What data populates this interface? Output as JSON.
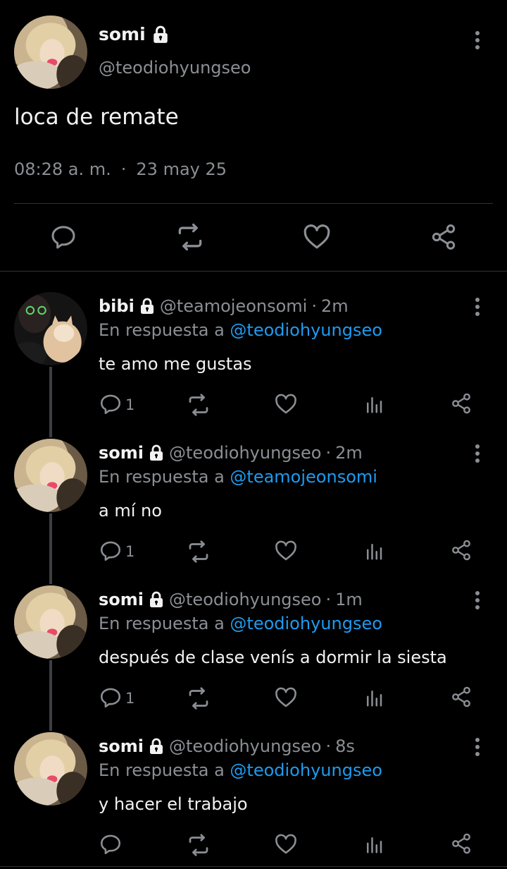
{
  "main_tweet": {
    "author_name": "somi",
    "author_handle": "@teodiohyungseo",
    "text": "loca de remate",
    "time": "08:28 a. m.",
    "separator": "·",
    "date": "23 may 25"
  },
  "replies": [
    {
      "name": "bibi",
      "handle": "@teamojeonsomi",
      "dot": "·",
      "time": "2m",
      "reply_prefix": "En respuesta a",
      "reply_to": "@teodiohyungseo",
      "text": "te amo me gustas",
      "reply_count": "1"
    },
    {
      "name": "somi",
      "handle": "@teodiohyungseo",
      "dot": "·",
      "time": "2m",
      "reply_prefix": "En respuesta a",
      "reply_to": "@teamojeonsomi",
      "text": "a mí no",
      "reply_count": "1"
    },
    {
      "name": "somi",
      "handle": "@teodiohyungseo",
      "dot": "·",
      "time": "1m",
      "reply_prefix": "En respuesta a",
      "reply_to": "@teodiohyungseo",
      "text": "después de clase venís a dormir la siesta",
      "reply_count": "1"
    },
    {
      "name": "somi",
      "handle": "@teodiohyungseo",
      "dot": "·",
      "time": "8s",
      "reply_prefix": "En respuesta a",
      "reply_to": "@teodiohyungseo",
      "text": "y hacer el trabajo",
      "reply_count": ""
    }
  ],
  "colors": {
    "background": "#000000",
    "text": "#e7e9ea",
    "secondary": "#8b8f94",
    "mention": "#1d9bf0",
    "divider": "#2f3336"
  },
  "icons": [
    "lock-icon",
    "more-icon",
    "reply-icon",
    "retweet-icon",
    "like-icon",
    "share-icon",
    "analytics-icon"
  ]
}
